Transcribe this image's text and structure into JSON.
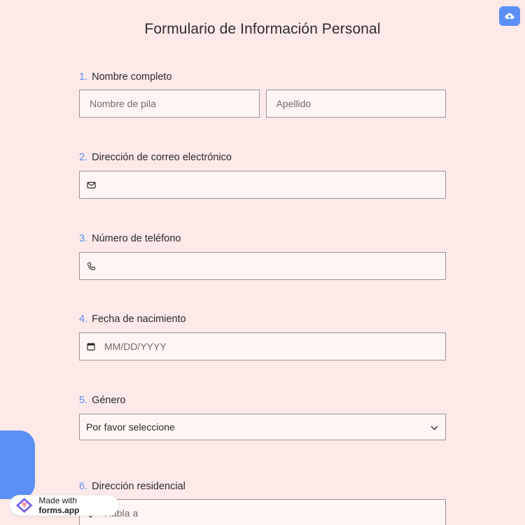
{
  "header": {
    "title": "Formulario de Información Personal"
  },
  "upload": {
    "icon": "cloud-upload-icon",
    "color": "#5b8ff5"
  },
  "questions": [
    {
      "number": "1.",
      "label": "Nombre completo",
      "first_placeholder": "Nombre de pila",
      "last_placeholder": "Apellido"
    },
    {
      "number": "2.",
      "label": "Dirección de correo electrónico",
      "icon": "mail-icon"
    },
    {
      "number": "3.",
      "label": "Número de teléfono",
      "icon": "phone-icon"
    },
    {
      "number": "4.",
      "label": "Fecha de nacimiento",
      "placeholder": "MM/DD/YYYY",
      "icon": "calendar-icon"
    },
    {
      "number": "5.",
      "label": "Género",
      "selected": "Por favor seleccione",
      "icon": "chevron-down-icon"
    },
    {
      "number": "6.",
      "label": "Dirección residencial",
      "placeholder": "Habla a",
      "icon": "location-icon"
    }
  ],
  "badge": {
    "prefix": "Made with",
    "brand": "forms.app"
  },
  "colors": {
    "background": "#fde9e8",
    "accent": "#5b8ff5",
    "field_bg": "#fff6f4"
  }
}
